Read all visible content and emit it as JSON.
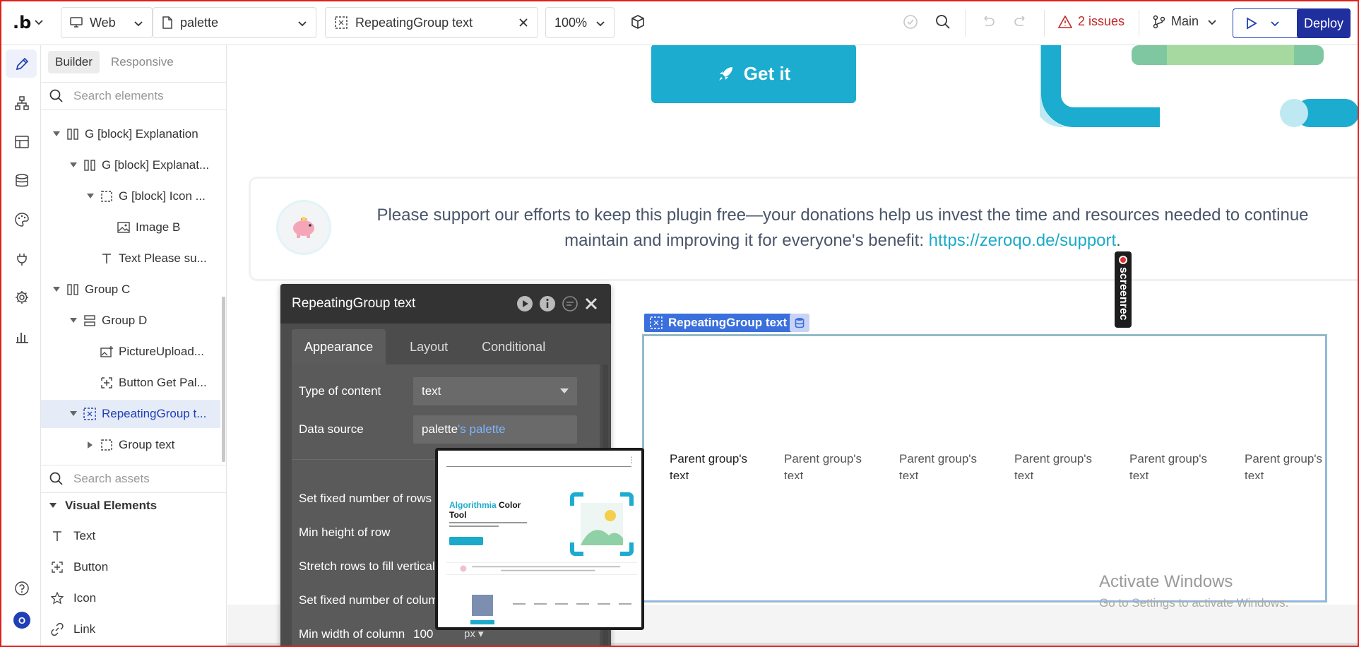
{
  "topbar": {
    "logo": ".b",
    "platform": "Web",
    "page": "palette",
    "element": "RepeatingGroup text",
    "zoom": "100%",
    "issues": "2 issues",
    "branch": "Main",
    "deploy": "Deploy"
  },
  "panel": {
    "tabs": [
      "Builder",
      "Responsive"
    ],
    "search_placeholder": "Search elements",
    "tree": [
      {
        "label": "G [block] Explanation"
      },
      {
        "label": "G [block] Explanat..."
      },
      {
        "label": "G [block] Icon ..."
      },
      {
        "label": "Image B"
      },
      {
        "label": "Text Please su..."
      },
      {
        "label": "Group C"
      },
      {
        "label": "Group D"
      },
      {
        "label": "PictureUpload..."
      },
      {
        "label": "Button Get Pal..."
      },
      {
        "label": "RepeatingGroup t..."
      },
      {
        "label": "Group text"
      }
    ],
    "assets_placeholder": "Search assets",
    "section": "Visual Elements",
    "assets": [
      "Text",
      "Button",
      "Icon",
      "Link"
    ]
  },
  "canvas": {
    "get_it": "Get it",
    "support_text": "Please support our efforts to keep this plugin free—your donations help us invest the time and resources needed to continue maintain and improving it for everyone's benefit:",
    "support_link": "https://zeroqo.de/support",
    "support_end": ".",
    "rg_label": "RepeatingGroup text",
    "cells": [
      "Parent group's text",
      "Parent group's text",
      "Parent group's text",
      "Parent group's text",
      "Parent group's text",
      "Parent group's text"
    ],
    "activate_title": "Activate Windows",
    "activate_sub": "Go to Settings to activate Windows.",
    "screenrec": "screenrec"
  },
  "editor": {
    "title": "RepeatingGroup text",
    "tabs": [
      "Appearance",
      "Layout",
      "Conditional"
    ],
    "type_label": "Type of content",
    "type_value": "text",
    "source_label": "Data source",
    "source_a": "palette",
    "source_b": "'s palette",
    "rows_label": "Set fixed number of rows",
    "minh_label": "Min height of row",
    "stretch_label": "Stretch rows to fill vertical space",
    "cols_label": "Set fixed number of columns",
    "minw_label": "Min width of column",
    "minw_value": "100",
    "minw_unit": "px"
  },
  "preview": {
    "title_a": "Algorithmia",
    "title_b": " Color Tool"
  }
}
